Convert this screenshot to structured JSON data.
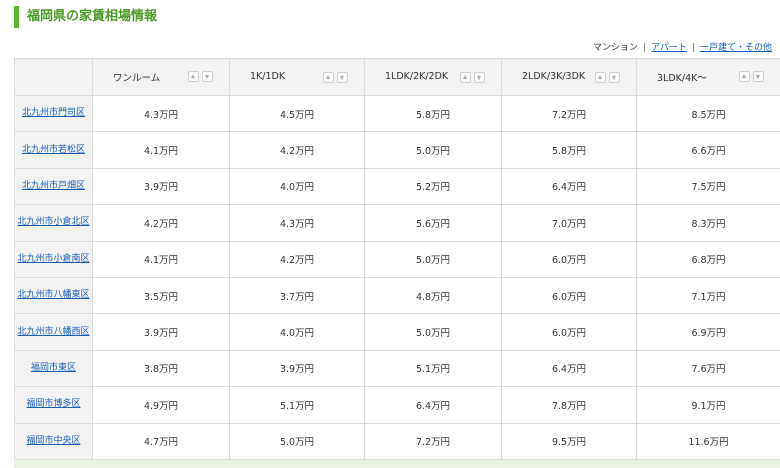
{
  "page": {
    "title": "福岡県の家賃相場情報"
  },
  "type_nav": {
    "current": "マンション",
    "separator": "|",
    "links": [
      "アパート",
      "一戸建て・その他"
    ]
  },
  "table": {
    "headers": [
      "ワンルーム",
      "1K/1DK",
      "1LDK/2K/2DK",
      "2LDK/3K/3DK",
      "3LDK/4K〜"
    ],
    "sort_icons": [
      "sort-ascending-icon",
      "sort-descending-icon"
    ],
    "rows": [
      {
        "area": "北九州市門司区",
        "values": [
          "4.3万円",
          "4.5万円",
          "5.8万円",
          "7.2万円",
          "8.5万円"
        ]
      },
      {
        "area": "北九州市若松区",
        "values": [
          "4.1万円",
          "4.2万円",
          "5.0万円",
          "5.8万円",
          "6.6万円"
        ]
      },
      {
        "area": "北九州市戸畑区",
        "values": [
          "3.9万円",
          "4.0万円",
          "5.2万円",
          "6.4万円",
          "7.5万円"
        ]
      },
      {
        "area": "北九州市小倉北区",
        "values": [
          "4.2万円",
          "4.3万円",
          "5.6万円",
          "7.0万円",
          "8.3万円"
        ]
      },
      {
        "area": "北九州市小倉南区",
        "values": [
          "4.1万円",
          "4.2万円",
          "5.0万円",
          "6.0万円",
          "6.8万円"
        ]
      },
      {
        "area": "北九州市八幡東区",
        "values": [
          "3.5万円",
          "3.7万円",
          "4.8万円",
          "6.0万円",
          "7.1万円"
        ]
      },
      {
        "area": "北九州市八幡西区",
        "values": [
          "3.9万円",
          "4.0万円",
          "5.0万円",
          "6.0万円",
          "6.9万円"
        ]
      },
      {
        "area": "福岡市東区",
        "values": [
          "3.8万円",
          "3.9万円",
          "5.1万円",
          "6.4万円",
          "7.6万円"
        ]
      },
      {
        "area": "福岡市博多区",
        "values": [
          "4.9万円",
          "5.1万円",
          "6.4万円",
          "7.8万円",
          "9.1万円"
        ]
      },
      {
        "area": "福岡市中央区",
        "values": [
          "4.7万円",
          "5.0万円",
          "7.2万円",
          "9.5万円",
          "11.6万円"
        ]
      }
    ]
  },
  "colors": {
    "accent_green": "#5cb531",
    "title_green": "#4a9a28",
    "link_blue": "#1a5fb4",
    "header_bg": "#f2f2f2",
    "border": "#dcdcdc"
  }
}
